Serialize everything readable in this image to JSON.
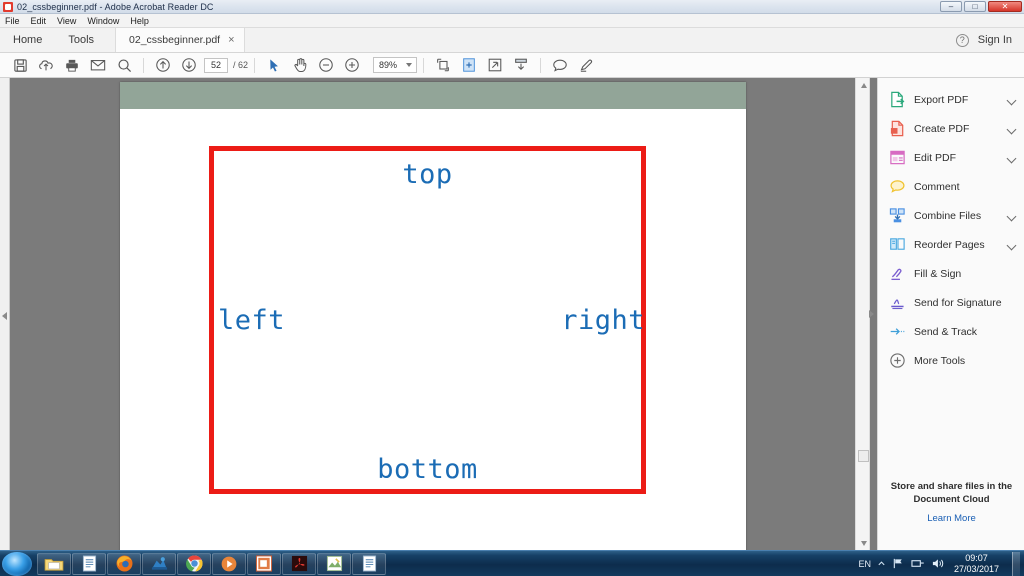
{
  "window": {
    "title": "02_cssbeginner.pdf - Adobe Acrobat Reader DC",
    "minimize_label": "–",
    "maximize_label": "□",
    "close_label": "✕"
  },
  "menubar": {
    "items": [
      {
        "label": "File"
      },
      {
        "label": "Edit"
      },
      {
        "label": "View"
      },
      {
        "label": "Window"
      },
      {
        "label": "Help"
      }
    ]
  },
  "tabbar": {
    "home_label": "Home",
    "tools_label": "Tools",
    "file_tab_label": "02_cssbeginner.pdf",
    "file_tab_close": "×",
    "help_label": "?",
    "signin_label": "Sign In"
  },
  "toolbar": {
    "buttons": [
      {
        "name": "save-icon",
        "title": "Save"
      },
      {
        "name": "upload-cloud-icon",
        "title": "Save to cloud"
      },
      {
        "name": "print-icon",
        "title": "Print"
      },
      {
        "name": "email-icon",
        "title": "Email"
      },
      {
        "name": "search-icon",
        "title": "Find"
      },
      {
        "name": "page-up-icon",
        "title": "Previous page"
      },
      {
        "name": "page-down-icon",
        "title": "Next page"
      },
      {
        "name": "select-cursor-icon",
        "title": "Select tool"
      },
      {
        "name": "hand-tool-icon",
        "title": "Hand tool"
      },
      {
        "name": "zoom-out-icon",
        "title": "Zoom out"
      },
      {
        "name": "zoom-in-icon",
        "title": "Zoom in"
      },
      {
        "name": "fit-width-icon",
        "title": "Fit width"
      },
      {
        "name": "fit-page-icon",
        "title": "Fit page"
      },
      {
        "name": "fullscreen-icon",
        "title": "Full screen"
      },
      {
        "name": "scroll-mode-icon",
        "title": "Scrolling mode"
      },
      {
        "name": "comment-icon",
        "title": "Comment"
      },
      {
        "name": "highlighter-icon",
        "title": "Highlight text"
      }
    ],
    "page_current": "52",
    "page_total": "/ 62",
    "zoom_value": "89%"
  },
  "document": {
    "red_box": {
      "top_label": "top",
      "left_label": "left",
      "right_label": "right",
      "bottom_label": "bottom"
    },
    "colors": {
      "border": "#ec1c16",
      "text": "#1b6cb5",
      "band": "#92a598"
    }
  },
  "rightpanel": {
    "tools": [
      {
        "label": "Export PDF",
        "icon": "export-pdf-icon",
        "color": "#2aa87b",
        "chevron": true
      },
      {
        "label": "Create PDF",
        "icon": "create-pdf-icon",
        "color": "#e8604f",
        "chevron": true
      },
      {
        "label": "Edit PDF",
        "icon": "edit-pdf-icon",
        "color": "#d76bc2",
        "chevron": true
      },
      {
        "label": "Comment",
        "icon": "comment-icon",
        "color": "#f0c330",
        "chevron": false
      },
      {
        "label": "Combine Files",
        "icon": "combine-files-icon",
        "color": "#4a90e2",
        "chevron": true
      },
      {
        "label": "Reorder Pages",
        "icon": "reorder-pages-icon",
        "color": "#4aa8e0",
        "chevron": true
      },
      {
        "label": "Fill & Sign",
        "icon": "fill-sign-icon",
        "color": "#7b5ed0",
        "chevron": false
      },
      {
        "label": "Send for Signature",
        "icon": "send-signature-icon",
        "color": "#6a5acd",
        "chevron": false
      },
      {
        "label": "Send & Track",
        "icon": "send-track-icon",
        "color": "#3f9fd8",
        "chevron": false
      },
      {
        "label": "More Tools",
        "icon": "more-tools-icon",
        "color": "#6e6e6e",
        "chevron": false
      }
    ],
    "promo_line1": "Store and share files in the",
    "promo_line2": "Document Cloud",
    "promo_link": "Learn More"
  },
  "taskbar": {
    "start_label": "Start",
    "items": [
      {
        "name": "explorer-icon"
      },
      {
        "name": "word-document-icon"
      },
      {
        "name": "firefox-icon"
      },
      {
        "name": "blue-app-icon"
      },
      {
        "name": "chrome-icon"
      },
      {
        "name": "media-player-icon"
      },
      {
        "name": "powerpoint-icon"
      },
      {
        "name": "acrobat-icon"
      },
      {
        "name": "paint-icon"
      },
      {
        "name": "word-document-2-icon"
      }
    ],
    "language": "EN",
    "time": "09:07",
    "date": "27/03/2017"
  }
}
